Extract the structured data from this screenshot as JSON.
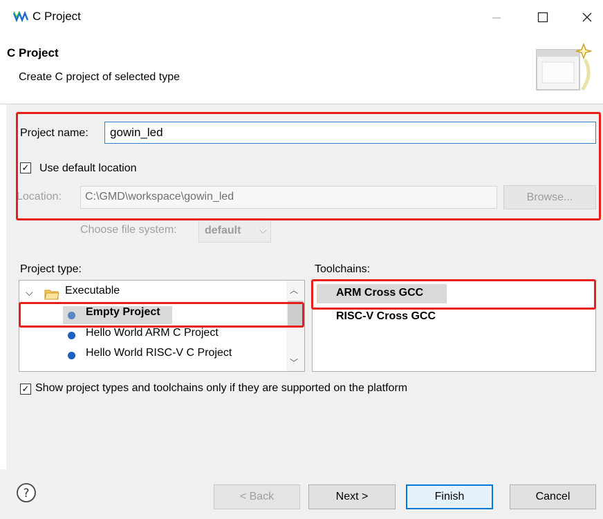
{
  "window": {
    "title": "C Project"
  },
  "header": {
    "title": "C Project",
    "description": "Create C project of selected type"
  },
  "form": {
    "project_name_label": "Project name:",
    "project_name_value": "gowin_led",
    "use_default_location_label": "Use default location",
    "use_default_location_checked": true,
    "location_label": "Location:",
    "location_value": "C:\\GMD\\workspace\\gowin_led",
    "browse_label": "Browse...",
    "file_system_label": "Choose file system:",
    "file_system_value": "default"
  },
  "project_type": {
    "label": "Project type:",
    "category": "Executable",
    "items": [
      {
        "label": "Empty Project",
        "selected": true
      },
      {
        "label": "Hello World ARM C Project",
        "selected": false
      },
      {
        "label": "Hello World RISC-V C Project",
        "selected": false
      }
    ]
  },
  "toolchains": {
    "label": "Toolchains:",
    "items": [
      {
        "label": "ARM Cross GCC",
        "selected": true
      },
      {
        "label": "RISC-V Cross GCC",
        "selected": false
      }
    ]
  },
  "show_supported": {
    "label": "Show project types and toolchains only if they are supported on the platform",
    "checked": true
  },
  "buttons": {
    "back": "< Back",
    "next": "Next >",
    "finish": "Finish",
    "cancel": "Cancel"
  },
  "colors": {
    "highlight": "#e8201c",
    "accent": "#0078d7",
    "content_bg": "#f0f0f0",
    "selection_bg": "#d9d9d9"
  },
  "icons": [
    "app-icon",
    "minimize-icon",
    "maximize-icon",
    "close-icon",
    "wizard-banner-icon",
    "folder-icon",
    "help-icon",
    "chevron-down-icon"
  ]
}
